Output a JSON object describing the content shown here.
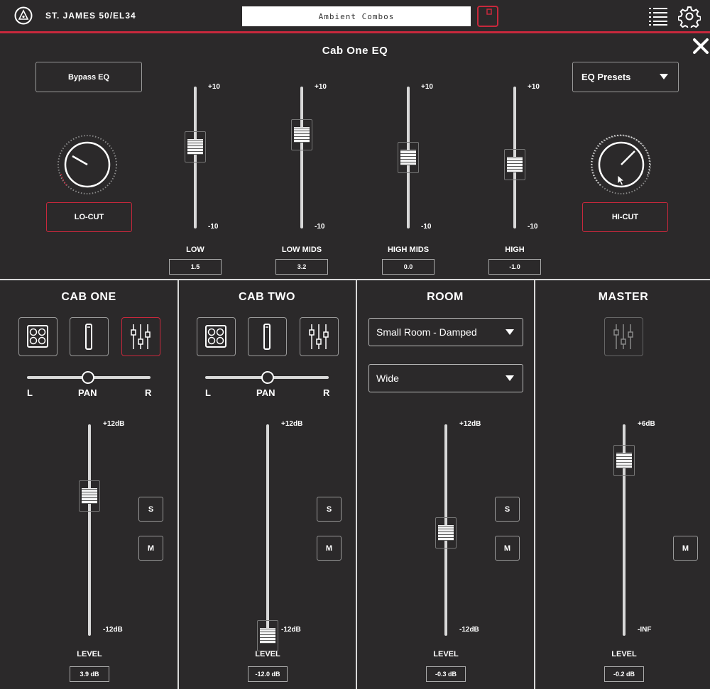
{
  "header": {
    "amp_name": "ST. JAMES 50/EL34",
    "preset_name": "Ambient Combos",
    "logo": "triangle-logo-icon",
    "save_icon": "save-icon",
    "list_icon": "list-icon",
    "settings_icon": "gear-icon"
  },
  "eq": {
    "title": "Cab One EQ",
    "bypass_label": "Bypass EQ",
    "presets_label": "EQ Presets",
    "locut_label": "LO-CUT",
    "hicut_label": "HI-CUT",
    "max_label": "+10",
    "min_label": "-10",
    "bands": [
      {
        "label": "LOW",
        "value": "1.5",
        "level": 1.5
      },
      {
        "label": "LOW MIDS",
        "value": "3.2",
        "level": 3.2
      },
      {
        "label": "HIGH MIDS",
        "value": "0.0",
        "level": 0.0
      },
      {
        "label": "HIGH",
        "value": "-1.0",
        "level": -1.0
      }
    ]
  },
  "channels": [
    {
      "title": "CAB ONE",
      "pan_label": "PAN",
      "left": "L",
      "right": "R",
      "max": "+12dB",
      "min": "-12dB",
      "level_label": "LEVEL",
      "level_value": "3.9 dB",
      "solo": "S",
      "mute": "M"
    },
    {
      "title": "CAB TWO",
      "pan_label": "PAN",
      "left": "L",
      "right": "R",
      "max": "+12dB",
      "min": "-12dB",
      "level_label": "LEVEL",
      "level_value": "-12.0 dB",
      "solo": "S",
      "mute": "M"
    },
    {
      "title": "ROOM",
      "room_type": "Small Room - Damped",
      "width": "Wide",
      "max": "+12dB",
      "min": "-12dB",
      "level_label": "LEVEL",
      "level_value": "-0.3 dB",
      "solo": "S",
      "mute": "M"
    },
    {
      "title": "MASTER",
      "max": "+6dB",
      "min": "-INF",
      "level_label": "LEVEL",
      "level_value": "-0.2 dB",
      "mute": "M"
    }
  ],
  "colors": {
    "background": "#2b292a",
    "accent": "#c8283c",
    "line": "#d8d8d8"
  }
}
